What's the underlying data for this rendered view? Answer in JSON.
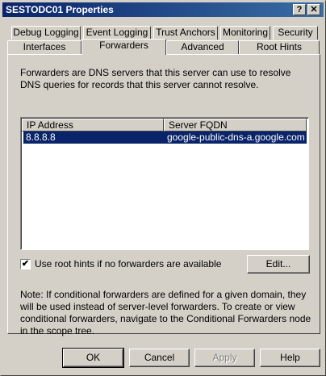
{
  "window": {
    "title": "SESTODC01 Properties",
    "help_label": "?",
    "close_label": "✕"
  },
  "tabs_back": [
    {
      "label": "Debug Logging"
    },
    {
      "label": "Event Logging"
    },
    {
      "label": "Trust Anchors"
    },
    {
      "label": "Monitoring"
    },
    {
      "label": "Security"
    }
  ],
  "tabs_front": [
    {
      "label": "Interfaces"
    },
    {
      "label": "Forwarders",
      "selected": true
    },
    {
      "label": "Advanced"
    },
    {
      "label": "Root Hints"
    }
  ],
  "forwarders": {
    "description": "Forwarders are DNS servers that this server can use to resolve DNS queries for records that this server cannot resolve.",
    "columns": [
      "IP Address",
      "Server FQDN"
    ],
    "rows": [
      {
        "ip": "8.8.8.8",
        "fqdn": "google-public-dns-a.google.com",
        "selected": true
      }
    ],
    "use_root_hints_label": "Use root hints if no forwarders are available",
    "use_root_hints_checked": true,
    "check_glyph": "✔",
    "edit_label": "Edit...",
    "note": "Note: If conditional forwarders are defined for a given domain, they will be used instead of server-level forwarders.  To create or view conditional forwarders, navigate to the Conditional Forwarders node in the scope tree."
  },
  "buttons": {
    "ok": "OK",
    "cancel": "Cancel",
    "apply": "Apply",
    "help": "Help"
  },
  "colors": {
    "title_bar": "#0a246a",
    "selection": "#0a246a",
    "face": "#d4d0c8"
  }
}
